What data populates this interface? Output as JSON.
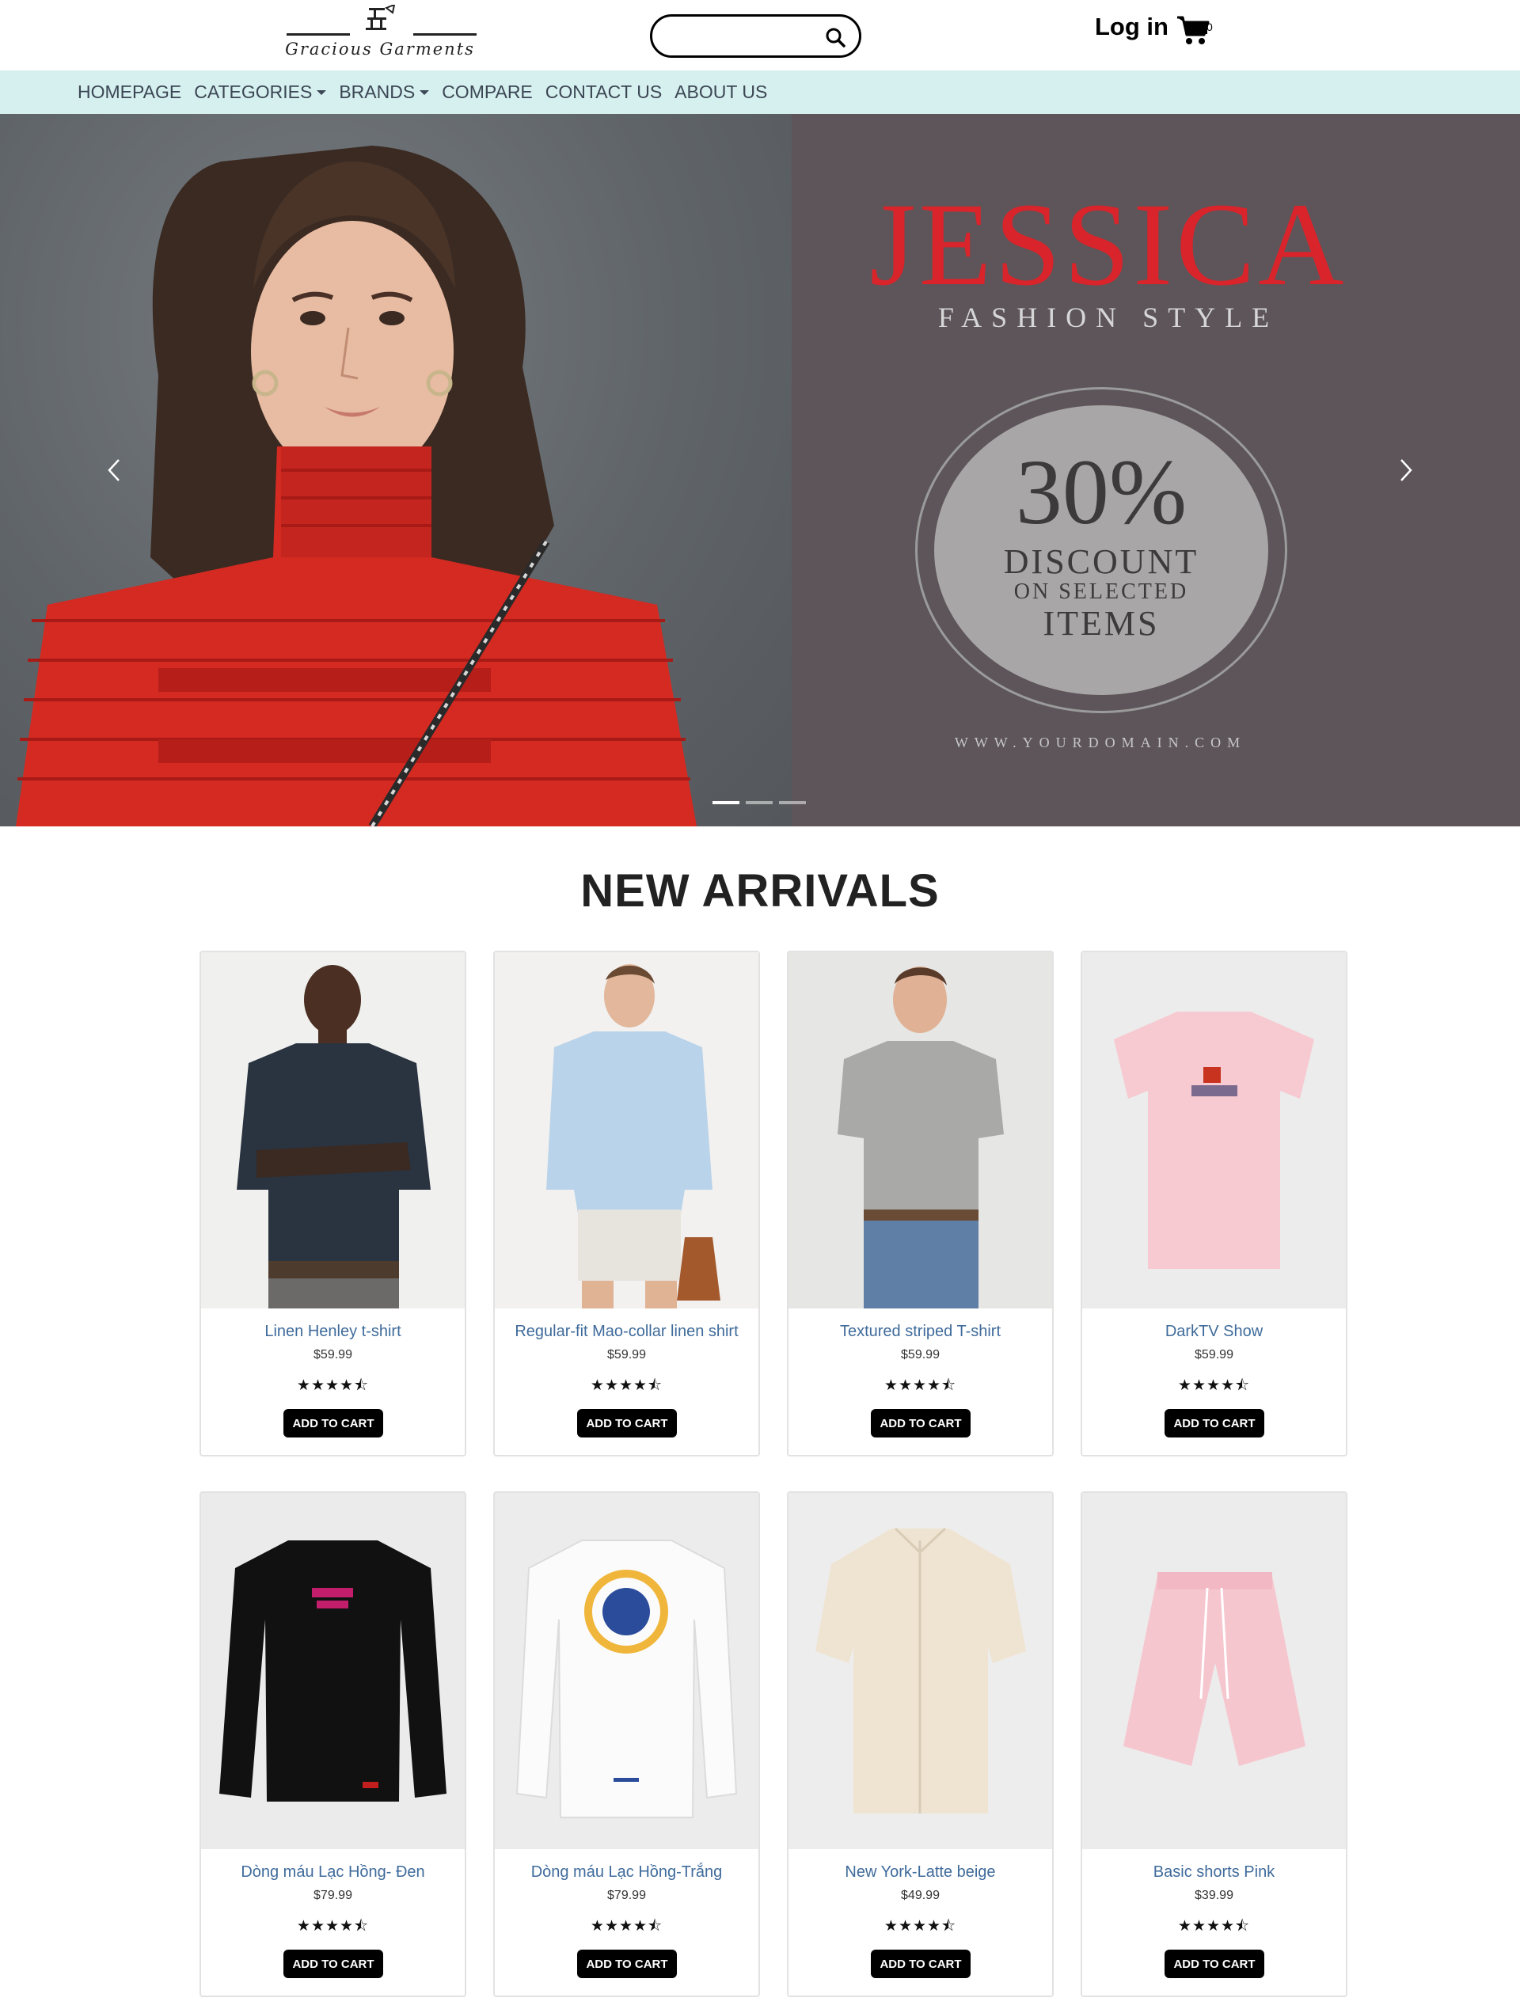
{
  "header": {
    "logo_text": "Gracious Garments",
    "search_placeholder": "",
    "login_label": "Log in",
    "cart_count": "0"
  },
  "nav": {
    "items": [
      {
        "label": "HOMEPAGE",
        "dropdown": false
      },
      {
        "label": "CATEGORIES",
        "dropdown": true
      },
      {
        "label": "BRANDS",
        "dropdown": true
      },
      {
        "label": "COMPARE",
        "dropdown": false
      },
      {
        "label": "CONTACT US",
        "dropdown": false
      },
      {
        "label": "ABOUT US",
        "dropdown": false
      }
    ]
  },
  "hero": {
    "title": "JESSICA",
    "subtitle": "FASHION STYLE",
    "discount_percent": "30%",
    "discount_word": "DISCOUNT",
    "discount_on": "ON SELECTED",
    "discount_items": "ITEMS",
    "domain": "WWW.YOURDOMAIN.COM",
    "slide_count": 3,
    "active_slide": 0
  },
  "section": {
    "title": "NEW ARRIVALS"
  },
  "products": [
    {
      "name": "Linen Henley t-shirt",
      "price": "$59.99",
      "rating": 4.5,
      "stars": "★★★★⯪",
      "button": "ADD TO CART"
    },
    {
      "name": "Regular-fit Mao-collar linen shirt",
      "price": "$59.99",
      "rating": 4.5,
      "stars": "★★★★⯪",
      "button": "ADD TO CART"
    },
    {
      "name": "Textured striped T-shirt",
      "price": "$59.99",
      "rating": 4.5,
      "stars": "★★★★⯪",
      "button": "ADD TO CART"
    },
    {
      "name": "DarkTV Show",
      "price": "$59.99",
      "rating": 4.5,
      "stars": "★★★★⯪",
      "button": "ADD TO CART"
    },
    {
      "name": "Dòng máu Lạc Hồng- Đen",
      "price": "$79.99",
      "rating": 4.5,
      "stars": "★★★★⯪",
      "button": "ADD TO CART"
    },
    {
      "name": "Dòng máu Lạc Hồng-Trắng",
      "price": "$79.99",
      "rating": 4.5,
      "stars": "★★★★⯪",
      "button": "ADD TO CART"
    },
    {
      "name": "New York-Latte beige",
      "price": "$49.99",
      "rating": 4.5,
      "stars": "★★★★⯪",
      "button": "ADD TO CART"
    },
    {
      "name": "Basic shorts Pink",
      "price": "$39.99",
      "rating": 4.5,
      "stars": "★★★★⯪",
      "button": "ADD TO CART"
    }
  ],
  "colors": {
    "nav_bg": "#d6efef",
    "hero_bg": "#5d5559",
    "brand_red": "#d9242b",
    "link_blue": "#3f6b9b",
    "button_bg": "#000000"
  }
}
